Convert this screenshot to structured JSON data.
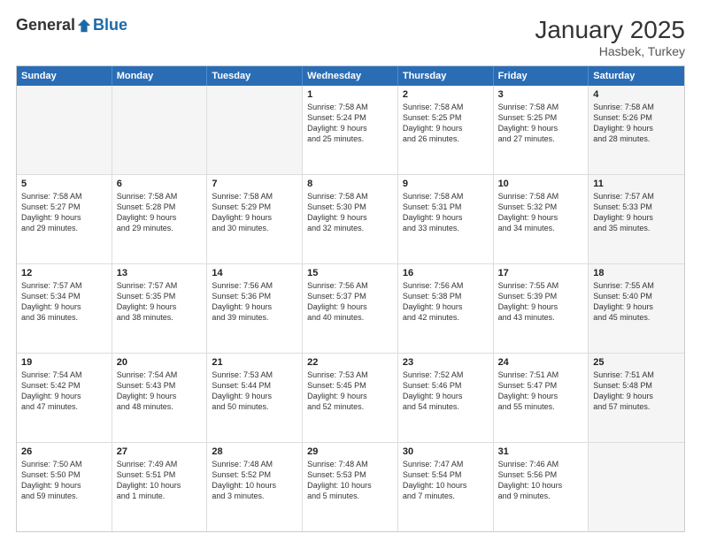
{
  "header": {
    "logo_general": "General",
    "logo_blue": "Blue",
    "month": "January 2025",
    "location": "Hasbek, Turkey"
  },
  "weekdays": [
    "Sunday",
    "Monday",
    "Tuesday",
    "Wednesday",
    "Thursday",
    "Friday",
    "Saturday"
  ],
  "rows": [
    [
      {
        "day": "",
        "text": "",
        "shaded": true
      },
      {
        "day": "",
        "text": "",
        "shaded": true
      },
      {
        "day": "",
        "text": "",
        "shaded": true
      },
      {
        "day": "1",
        "text": "Sunrise: 7:58 AM\nSunset: 5:24 PM\nDaylight: 9 hours\nand 25 minutes.",
        "shaded": false
      },
      {
        "day": "2",
        "text": "Sunrise: 7:58 AM\nSunset: 5:25 PM\nDaylight: 9 hours\nand 26 minutes.",
        "shaded": false
      },
      {
        "day": "3",
        "text": "Sunrise: 7:58 AM\nSunset: 5:25 PM\nDaylight: 9 hours\nand 27 minutes.",
        "shaded": false
      },
      {
        "day": "4",
        "text": "Sunrise: 7:58 AM\nSunset: 5:26 PM\nDaylight: 9 hours\nand 28 minutes.",
        "shaded": true
      }
    ],
    [
      {
        "day": "5",
        "text": "Sunrise: 7:58 AM\nSunset: 5:27 PM\nDaylight: 9 hours\nand 29 minutes.",
        "shaded": false
      },
      {
        "day": "6",
        "text": "Sunrise: 7:58 AM\nSunset: 5:28 PM\nDaylight: 9 hours\nand 29 minutes.",
        "shaded": false
      },
      {
        "day": "7",
        "text": "Sunrise: 7:58 AM\nSunset: 5:29 PM\nDaylight: 9 hours\nand 30 minutes.",
        "shaded": false
      },
      {
        "day": "8",
        "text": "Sunrise: 7:58 AM\nSunset: 5:30 PM\nDaylight: 9 hours\nand 32 minutes.",
        "shaded": false
      },
      {
        "day": "9",
        "text": "Sunrise: 7:58 AM\nSunset: 5:31 PM\nDaylight: 9 hours\nand 33 minutes.",
        "shaded": false
      },
      {
        "day": "10",
        "text": "Sunrise: 7:58 AM\nSunset: 5:32 PM\nDaylight: 9 hours\nand 34 minutes.",
        "shaded": false
      },
      {
        "day": "11",
        "text": "Sunrise: 7:57 AM\nSunset: 5:33 PM\nDaylight: 9 hours\nand 35 minutes.",
        "shaded": true
      }
    ],
    [
      {
        "day": "12",
        "text": "Sunrise: 7:57 AM\nSunset: 5:34 PM\nDaylight: 9 hours\nand 36 minutes.",
        "shaded": false
      },
      {
        "day": "13",
        "text": "Sunrise: 7:57 AM\nSunset: 5:35 PM\nDaylight: 9 hours\nand 38 minutes.",
        "shaded": false
      },
      {
        "day": "14",
        "text": "Sunrise: 7:56 AM\nSunset: 5:36 PM\nDaylight: 9 hours\nand 39 minutes.",
        "shaded": false
      },
      {
        "day": "15",
        "text": "Sunrise: 7:56 AM\nSunset: 5:37 PM\nDaylight: 9 hours\nand 40 minutes.",
        "shaded": false
      },
      {
        "day": "16",
        "text": "Sunrise: 7:56 AM\nSunset: 5:38 PM\nDaylight: 9 hours\nand 42 minutes.",
        "shaded": false
      },
      {
        "day": "17",
        "text": "Sunrise: 7:55 AM\nSunset: 5:39 PM\nDaylight: 9 hours\nand 43 minutes.",
        "shaded": false
      },
      {
        "day": "18",
        "text": "Sunrise: 7:55 AM\nSunset: 5:40 PM\nDaylight: 9 hours\nand 45 minutes.",
        "shaded": true
      }
    ],
    [
      {
        "day": "19",
        "text": "Sunrise: 7:54 AM\nSunset: 5:42 PM\nDaylight: 9 hours\nand 47 minutes.",
        "shaded": false
      },
      {
        "day": "20",
        "text": "Sunrise: 7:54 AM\nSunset: 5:43 PM\nDaylight: 9 hours\nand 48 minutes.",
        "shaded": false
      },
      {
        "day": "21",
        "text": "Sunrise: 7:53 AM\nSunset: 5:44 PM\nDaylight: 9 hours\nand 50 minutes.",
        "shaded": false
      },
      {
        "day": "22",
        "text": "Sunrise: 7:53 AM\nSunset: 5:45 PM\nDaylight: 9 hours\nand 52 minutes.",
        "shaded": false
      },
      {
        "day": "23",
        "text": "Sunrise: 7:52 AM\nSunset: 5:46 PM\nDaylight: 9 hours\nand 54 minutes.",
        "shaded": false
      },
      {
        "day": "24",
        "text": "Sunrise: 7:51 AM\nSunset: 5:47 PM\nDaylight: 9 hours\nand 55 minutes.",
        "shaded": false
      },
      {
        "day": "25",
        "text": "Sunrise: 7:51 AM\nSunset: 5:48 PM\nDaylight: 9 hours\nand 57 minutes.",
        "shaded": true
      }
    ],
    [
      {
        "day": "26",
        "text": "Sunrise: 7:50 AM\nSunset: 5:50 PM\nDaylight: 9 hours\nand 59 minutes.",
        "shaded": false
      },
      {
        "day": "27",
        "text": "Sunrise: 7:49 AM\nSunset: 5:51 PM\nDaylight: 10 hours\nand 1 minute.",
        "shaded": false
      },
      {
        "day": "28",
        "text": "Sunrise: 7:48 AM\nSunset: 5:52 PM\nDaylight: 10 hours\nand 3 minutes.",
        "shaded": false
      },
      {
        "day": "29",
        "text": "Sunrise: 7:48 AM\nSunset: 5:53 PM\nDaylight: 10 hours\nand 5 minutes.",
        "shaded": false
      },
      {
        "day": "30",
        "text": "Sunrise: 7:47 AM\nSunset: 5:54 PM\nDaylight: 10 hours\nand 7 minutes.",
        "shaded": false
      },
      {
        "day": "31",
        "text": "Sunrise: 7:46 AM\nSunset: 5:56 PM\nDaylight: 10 hours\nand 9 minutes.",
        "shaded": false
      },
      {
        "day": "",
        "text": "",
        "shaded": true
      }
    ]
  ]
}
